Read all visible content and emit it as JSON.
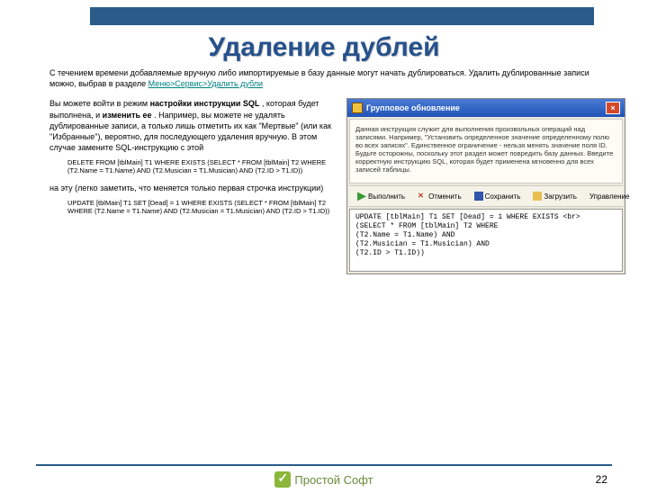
{
  "slide": {
    "title": "Удаление дублей",
    "intro_part1": "С течением времени добавляемые вручную либо импортируемые в базу данные могут начать дублироваться. Удалить дублированные записи можно, выбрав в разделе ",
    "menu_path": "Меню>Сервис>Удалить дубли",
    "left": {
      "p1_a": "Вы можете войти в режим ",
      "p1_b": "настройки инструкции SQL",
      "p1_c": ", которая будет выполнена, и ",
      "p1_d": "изменить ее",
      "p1_e": ". Например, вы можете не удалять дублированные записи, а только лишь отметить их как \"Мертвые\" (или как \"Избранные\"), вероятно, для последующего удаления вручную. В этом случае замените SQL-инструкцию с этой",
      "sql1": "DELETE FROM [tblMain] T1 WHERE EXISTS (SELECT * FROM [tblMain] T2 WHERE (T2.Name = T1.Name) AND (T2.Musician = T1.Musician) AND (T2.ID > T1.ID))",
      "p2": "на эту (легко заметить, что меняется только первая строчка инструкции)",
      "sql2": "UPDATE [tblMain] T1 SET [Dead] = 1 WHERE EXISTS (SELECT * FROM [tblMain] T2 WHERE (T2.Name = T1.Name) AND (T2.Musician = T1.Musician) AND (T2.ID > T1.ID))"
    }
  },
  "window": {
    "title": "Групповое обновление",
    "desc": "Данная инструкция служит для выполнения произвольных операций над записями. Например, \"Установить определенное значение определенному полю во всех записях\". Единственное ограничение - нельзя менять значение поля ID. Будьте осторожны, поскольку этот раздел может повредить базу данных. Введите корректную инструкцию SQL, которая будет применена мгновенно для всех записей таблицы.",
    "toolbar": {
      "run": "Выполнить",
      "cancel": "Отменить",
      "save": "Сохранить",
      "load": "Загрузить",
      "manage": "Управление"
    },
    "sql_lines": [
      "UPDATE [tblMain] T1 SET [Dead] = 1 WHERE EXISTS <br>",
      "(SELECT * FROM [tblMain] T2 WHERE",
      "(T2.Name = T1.Name) AND",
      "(T2.Musician = T1.Musician) AND",
      "(T2.ID > T1.ID))"
    ]
  },
  "footer": {
    "brand": "Простой Софт",
    "page": "22"
  }
}
